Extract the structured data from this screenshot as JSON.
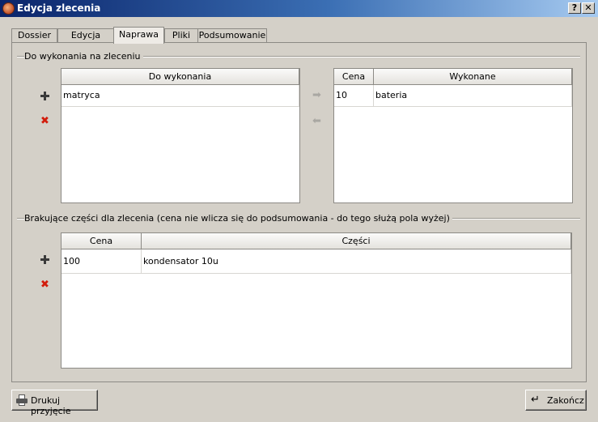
{
  "window": {
    "title": "Edycja zlecenia",
    "help_label": "?",
    "close_label": "✕"
  },
  "tabs": [
    {
      "label": "Dossier"
    },
    {
      "label": "Edycja"
    },
    {
      "label": "Naprawa"
    },
    {
      "label": "Pliki"
    },
    {
      "label": "Podsumowanie"
    }
  ],
  "active_tab": "Naprawa",
  "todo_group": {
    "title": "Do wykonania na zleceniu",
    "todo_table": {
      "header": "Do wykonania",
      "rows": [
        "matryca"
      ]
    },
    "done_table": {
      "headers": [
        "Cena",
        "Wykonane"
      ],
      "rows": [
        {
          "price": "10",
          "item": "bateria"
        }
      ]
    }
  },
  "parts_group": {
    "title": "Brakujące części dla zlecenia (cena nie wlicza się do podsumowania - do tego służą pola wyżej)",
    "table": {
      "headers": [
        "Cena",
        "Części"
      ],
      "rows": [
        {
          "price": "100",
          "item": "kondensator 10u"
        }
      ]
    }
  },
  "buttons": {
    "print": "Drukuj przyjęcie",
    "finish": "Zakończ"
  },
  "icons": {
    "app": "app-icon",
    "add": "plus-icon",
    "remove": "red-x-icon",
    "move_right": "arrow-right-icon",
    "move_left": "arrow-left-icon",
    "print": "printer-icon",
    "finish": "return-arrow-icon"
  }
}
